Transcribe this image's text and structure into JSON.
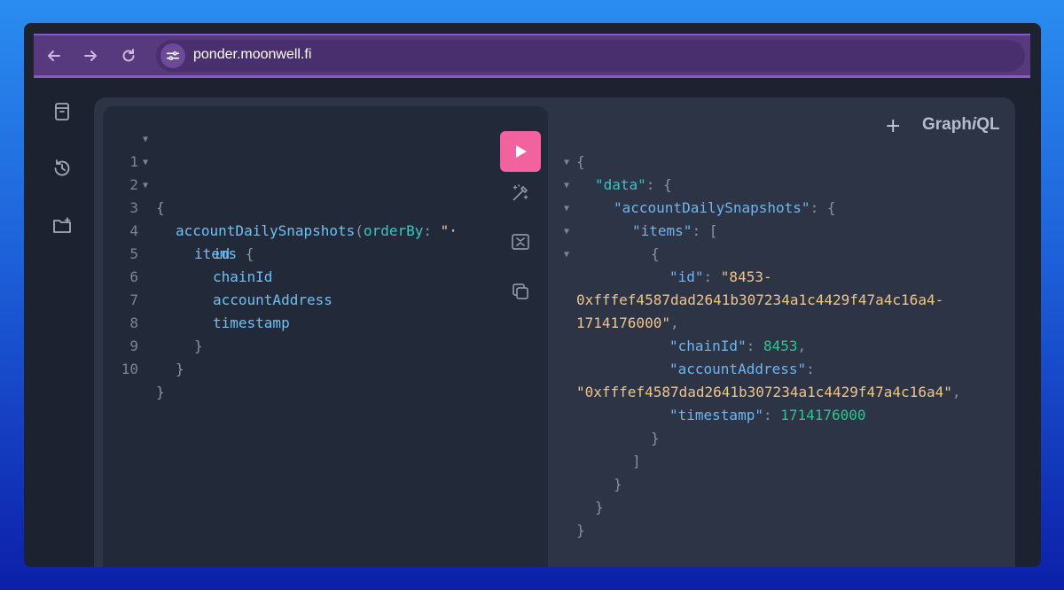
{
  "browser": {
    "url": "ponder.moonwell.fi",
    "back_icon": "arrow-left-icon",
    "forward_icon": "arrow-right-icon",
    "reload_icon": "reload-icon",
    "site_settings_icon": "tune-icon"
  },
  "sidebar": {
    "items": [
      {
        "name": "docs",
        "icon": "book-icon"
      },
      {
        "name": "history",
        "icon": "history-icon"
      },
      {
        "name": "explorer",
        "icon": "folder-plus-icon"
      }
    ]
  },
  "header": {
    "add_tab_label": "+",
    "brand_prefix": "Graph",
    "brand_i": "i",
    "brand_suffix": "QL"
  },
  "query": {
    "lines": [
      {
        "num": "1",
        "fold": true,
        "field": "",
        "text": "{"
      },
      {
        "num": "2",
        "fold": true,
        "field": "accountDailySnapshots",
        "paren": "(",
        "arg": "orderBy",
        "colon": ": ",
        "str": "\"·"
      },
      {
        "num": "3",
        "fold": true,
        "field": "items",
        "text": " {"
      },
      {
        "num": "4",
        "fold": false,
        "field": "id"
      },
      {
        "num": "5",
        "fold": false,
        "field": "chainId"
      },
      {
        "num": "6",
        "fold": false,
        "field": "accountAddress"
      },
      {
        "num": "7",
        "fold": false,
        "field": "timestamp"
      },
      {
        "num": "8",
        "fold": false,
        "text": "}"
      },
      {
        "num": "9",
        "fold": false,
        "text": "}"
      },
      {
        "num": "10",
        "fold": false,
        "text": "}"
      }
    ]
  },
  "toolbar": {
    "run_label": "Execute query",
    "prettify_icon": "magic-wand-icon",
    "merge_icon": "merge-fragments-icon",
    "copy_icon": "copy-icon"
  },
  "result": {
    "open_brace": "{",
    "data_key": "\"data\"",
    "snapshots_key": "\"accountDailySnapshots\"",
    "items_key": "\"items\"",
    "item_open": "{",
    "id_key": "\"id\"",
    "id_value_1": "\"8453-",
    "id_value_2": "0xfffef4587dad2641b307234a1c4429f47a4c16a4-",
    "id_value_3": "1714176000\"",
    "chainId_key": "\"chainId\"",
    "chainId_value": "8453",
    "accountAddress_key": "\"accountAddress\"",
    "accountAddress_value": "\"0xfffef4587dad2641b307234a1c4429f47a4c16a4\"",
    "timestamp_key": "\"timestamp\"",
    "timestamp_value": "1714176000",
    "close_brace": "}",
    "close_bracket": "]",
    "colon_open_brace": ": {",
    "colon_open_bracket": ": [",
    "colon": ": ",
    "comma": ","
  },
  "colors": {
    "run_button": "#f2629f",
    "field": "#6fc0f0",
    "argument": "#33c9c3",
    "string": "#f0c58c",
    "number": "#28c890",
    "address_bar": "#573a7e"
  }
}
